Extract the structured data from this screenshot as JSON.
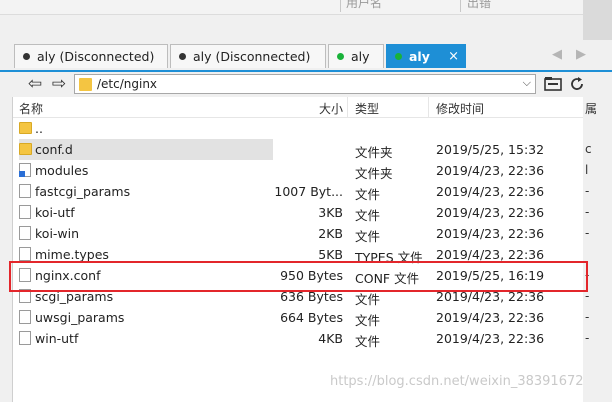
{
  "top_header": {
    "col_user": "用户名",
    "col_time": "出错"
  },
  "tabs": [
    {
      "label": "aly (Disconnected)",
      "status_color": "#333333",
      "active": false
    },
    {
      "label": "aly (Disconnected)",
      "status_color": "#333333",
      "active": false
    },
    {
      "label": "aly",
      "status_color": "#19b23a",
      "active": false
    },
    {
      "label": "aly",
      "status_color": "#19b23a",
      "active": true,
      "close": "×"
    }
  ],
  "tab_nav": {
    "prev": "◀",
    "next": "▶"
  },
  "address": {
    "back": "⇦",
    "forward": "⇨",
    "path": "/etc/nginx",
    "dropdown": "⌵"
  },
  "columns": {
    "name": "名称",
    "size": "大小",
    "type": "类型",
    "modified": "修改时间",
    "extra": "属"
  },
  "files": [
    {
      "icon": "folder",
      "name": "..",
      "size": "",
      "type": "",
      "date": "",
      "extra": ""
    },
    {
      "icon": "folder",
      "name": "conf.d",
      "size": "",
      "type": "文件夹",
      "date": "2019/5/25, 15:32",
      "extra": "c",
      "selected": true
    },
    {
      "icon": "link",
      "name": "modules",
      "size": "",
      "type": "文件夹",
      "date": "2019/4/23, 22:36",
      "extra": "l"
    },
    {
      "icon": "file",
      "name": "fastcgi_params",
      "size": "1007 Byt...",
      "type": "文件",
      "date": "2019/4/23, 22:36",
      "extra": "-"
    },
    {
      "icon": "file",
      "name": "koi-utf",
      "size": "3KB",
      "type": "文件",
      "date": "2019/4/23, 22:36",
      "extra": "-"
    },
    {
      "icon": "file",
      "name": "koi-win",
      "size": "2KB",
      "type": "文件",
      "date": "2019/4/23, 22:36",
      "extra": "-"
    },
    {
      "icon": "file",
      "name": "mime.types",
      "size": "5KB",
      "type": "TYPES 文件",
      "date": "2019/4/23, 22:36",
      "extra": ""
    },
    {
      "icon": "file",
      "name": "nginx.conf",
      "size": "950 Bytes",
      "type": "CONF 文件",
      "date": "2019/5/25, 16:19",
      "extra": "-"
    },
    {
      "icon": "file",
      "name": "scgi_params",
      "size": "636 Bytes",
      "type": "文件",
      "date": "2019/4/23, 22:36",
      "extra": "-"
    },
    {
      "icon": "file",
      "name": "uwsgi_params",
      "size": "664 Bytes",
      "type": "文件",
      "date": "2019/4/23, 22:36",
      "extra": "-"
    },
    {
      "icon": "file",
      "name": "win-utf",
      "size": "4KB",
      "type": "文件",
      "date": "2019/4/23, 22:36",
      "extra": "-"
    }
  ],
  "highlight_color": "#e3262b",
  "accent_color": "#1e8fd6",
  "watermark": "https://blog.csdn.net/weixin_38391672"
}
